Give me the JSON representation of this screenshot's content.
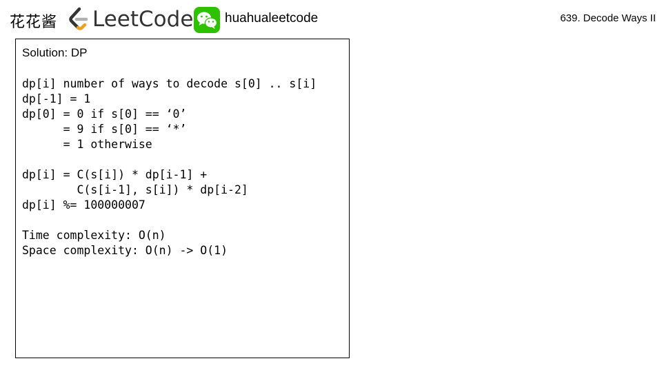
{
  "header": {
    "brand_cn": "花花酱",
    "leetcode_logo_text": "LeetCode",
    "channel": "huahualeetcode",
    "problem_title": "639. Decode Ways II"
  },
  "panel": {
    "title": "Solution: DP",
    "lines": [
      "dp[i] number of ways to decode s[0] .. s[i]",
      "dp[-1] = 1",
      "dp[0] = 0 if s[0] == ‘0’",
      "      = 9 if s[0] == ‘*’",
      "      = 1 otherwise",
      "",
      "dp[i] = C(s[i]) * dp[i-1] +",
      "        C(s[i-1], s[i]) * dp[i-2]",
      "dp[i] %= 100000007",
      "",
      "Time complexity: O(n)",
      "Space complexity: O(n) -> O(1)"
    ]
  },
  "colors": {
    "leetcode_orange": "#F0A020",
    "leetcode_gray": "#333333",
    "wechat_green": "#2DC100"
  },
  "icons": [
    "leetcode-logo-icon",
    "wechat-icon"
  ]
}
